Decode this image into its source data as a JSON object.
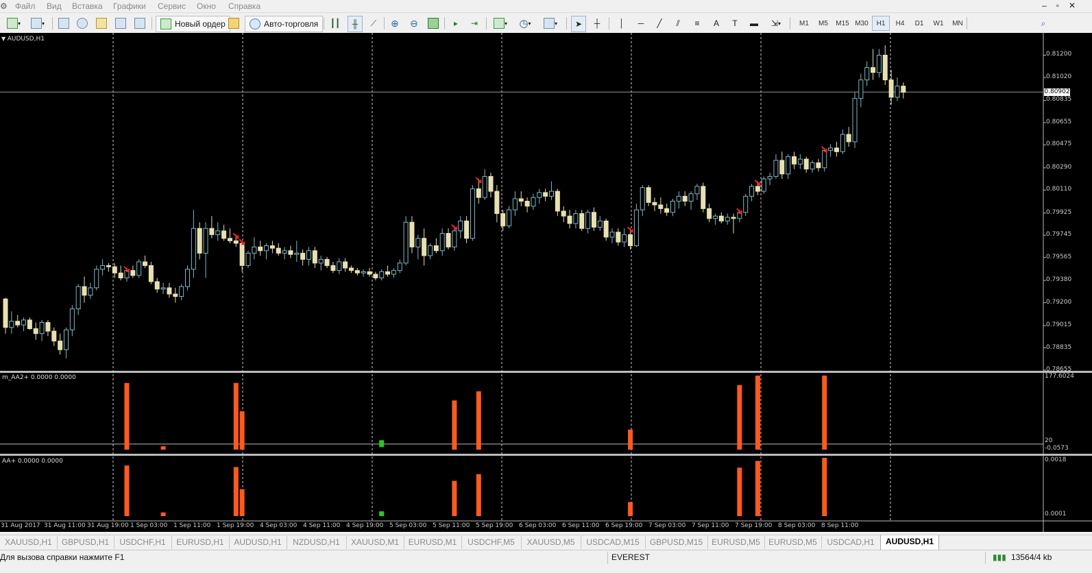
{
  "menu": [
    "Файл",
    "Вид",
    "Вставка",
    "Графики",
    "Сервис",
    "Окно",
    "Справка"
  ],
  "toolbar": {
    "new_order": "Новый ордер",
    "auto_trading": "Авто-торговля"
  },
  "timeframes": [
    "M1",
    "M5",
    "M15",
    "M30",
    "H1",
    "H4",
    "D1",
    "W1",
    "MN"
  ],
  "active_timeframe": "H1",
  "chart": {
    "title": "AUDUSD,H1",
    "current_price": "0.80902",
    "price_axis": [
      "0.81200",
      "0.81020",
      "0.80835",
      "0.80655",
      "0.80475",
      "0.80290",
      "0.80110",
      "0.79925",
      "0.79745",
      "0.79565",
      "0.79380",
      "0.79200",
      "0.79015",
      "0.78835",
      "0.78655"
    ],
    "time_axis": [
      "31 Aug 2017",
      "31 Aug 11:00",
      "31 Aug 19:00",
      "1 Sep 03:00",
      "1 Sep 11:00",
      "1 Sep 19:00",
      "4 Sep 03:00",
      "4 Sep 11:00",
      "4 Sep 19:00",
      "5 Sep 03:00",
      "5 Sep 11:00",
      "5 Sep 19:00",
      "6 Sep 03:00",
      "6 Sep 11:00",
      "6 Sep 19:00",
      "7 Sep 03:00",
      "7 Sep 11:00",
      "7 Sep 19:00",
      "8 Sep 03:00",
      "8 Sep 11:00"
    ]
  },
  "indicator1": {
    "label": "m_AA2+ 0.0000 0.0000",
    "axis_top": "177.6024",
    "axis_level": "20",
    "axis_bottom": "-0.0573"
  },
  "indicator2": {
    "label": "AA+ 0.0000 0.0000",
    "axis_top": "0.0018",
    "axis_bottom": "0.0001"
  },
  "tabs": [
    "XAUUSD,H1",
    "GBPUSD,H1",
    "USDCHF,H1",
    "EURUSD,H1",
    "AUDUSD,H1",
    "NZDUSD,H1",
    "XAUUSD,M1",
    "EURUSD,M1",
    "USDCHF,M5",
    "XAUUSD,M5",
    "USDCAD,M15",
    "GBPUSD,M15",
    "EURUSD,M5",
    "EURUSD,M5",
    "USDCAD,H1",
    "AUDUSD,H1"
  ],
  "active_tab_index": 15,
  "status": {
    "help": "Для вызова справки нажмите F1",
    "profile": "EVEREST",
    "traffic": "13564/4 kb"
  },
  "colors": {
    "chart_bg": "#000000",
    "bull_candle": "#7fb8c8",
    "bear_candle": "#e8e0b0",
    "histogram": "#ff5a1e",
    "signal_green": "#22cc22",
    "arrow": "#ff2020"
  },
  "chart_data": {
    "type": "candlestick",
    "symbol": "AUDUSD",
    "ylim": [
      0.78655,
      0.8138
    ],
    "ohlc": [
      [
        0.7923,
        0.7924,
        0.7895,
        0.79
      ],
      [
        0.79,
        0.7913,
        0.7895,
        0.7905
      ],
      [
        0.7905,
        0.791,
        0.79,
        0.7902
      ],
      [
        0.7902,
        0.7908,
        0.7897,
        0.7906
      ],
      [
        0.7906,
        0.7908,
        0.7898,
        0.7899
      ],
      [
        0.7899,
        0.7904,
        0.789,
        0.7895
      ],
      [
        0.7895,
        0.7906,
        0.7889,
        0.7904
      ],
      [
        0.7904,
        0.7906,
        0.7893,
        0.7897
      ],
      [
        0.7897,
        0.79,
        0.7885,
        0.7889
      ],
      [
        0.7889,
        0.7895,
        0.7878,
        0.7882
      ],
      [
        0.7882,
        0.79,
        0.7875,
        0.7898
      ],
      [
        0.7898,
        0.7918,
        0.7893,
        0.7915
      ],
      [
        0.7915,
        0.7935,
        0.791,
        0.7933
      ],
      [
        0.7933,
        0.7941,
        0.792,
        0.7926
      ],
      [
        0.7926,
        0.7936,
        0.7923,
        0.7932
      ],
      [
        0.7932,
        0.795,
        0.793,
        0.7947
      ],
      [
        0.7947,
        0.7955,
        0.7942,
        0.795
      ],
      [
        0.795,
        0.7952,
        0.7945,
        0.7949
      ],
      [
        0.7949,
        0.7952,
        0.794,
        0.7944
      ],
      [
        0.7944,
        0.795,
        0.7938,
        0.794
      ],
      [
        0.794,
        0.7948,
        0.7937,
        0.7946
      ],
      [
        0.7946,
        0.795,
        0.794,
        0.7942
      ],
      [
        0.7942,
        0.7955,
        0.794,
        0.7953
      ],
      [
        0.7953,
        0.7958,
        0.7948,
        0.795
      ],
      [
        0.795,
        0.7953,
        0.7935,
        0.7937
      ],
      [
        0.7937,
        0.794,
        0.7928,
        0.7931
      ],
      [
        0.7931,
        0.7936,
        0.7927,
        0.7932
      ],
      [
        0.7932,
        0.7936,
        0.7924,
        0.7927
      ],
      [
        0.7927,
        0.7932,
        0.792,
        0.7925
      ],
      [
        0.7925,
        0.7935,
        0.7922,
        0.7933
      ],
      [
        0.7933,
        0.795,
        0.793,
        0.7947
      ],
      [
        0.7947,
        0.7995,
        0.794,
        0.798
      ],
      [
        0.798,
        0.7985,
        0.7955,
        0.796
      ],
      [
        0.796,
        0.7985,
        0.794,
        0.798
      ],
      [
        0.798,
        0.799,
        0.7972,
        0.7975
      ],
      [
        0.7975,
        0.7985,
        0.797,
        0.7978
      ],
      [
        0.7978,
        0.7983,
        0.797,
        0.7972
      ],
      [
        0.7972,
        0.798,
        0.7968,
        0.797
      ],
      [
        0.797,
        0.7975,
        0.7965,
        0.7968
      ],
      [
        0.7968,
        0.797,
        0.7945,
        0.795
      ],
      [
        0.795,
        0.7962,
        0.7948,
        0.796
      ],
      [
        0.796,
        0.7973,
        0.7955,
        0.7965
      ],
      [
        0.7965,
        0.797,
        0.7958,
        0.7962
      ],
      [
        0.7962,
        0.7968,
        0.7955,
        0.7966
      ],
      [
        0.7966,
        0.797,
        0.796,
        0.7964
      ],
      [
        0.7964,
        0.7968,
        0.7958,
        0.796
      ],
      [
        0.796,
        0.7965,
        0.7955,
        0.7962
      ],
      [
        0.7962,
        0.7966,
        0.7956,
        0.7959
      ],
      [
        0.7959,
        0.797,
        0.7953,
        0.796
      ],
      [
        0.796,
        0.7963,
        0.795,
        0.7955
      ],
      [
        0.7955,
        0.7965,
        0.795,
        0.7962
      ],
      [
        0.7962,
        0.7965,
        0.7948,
        0.7952
      ],
      [
        0.7952,
        0.7958,
        0.7946,
        0.7955
      ],
      [
        0.7955,
        0.7957,
        0.7948,
        0.795
      ],
      [
        0.795,
        0.7953,
        0.7944,
        0.7946
      ],
      [
        0.7946,
        0.7956,
        0.7943,
        0.7953
      ],
      [
        0.7953,
        0.7956,
        0.7945,
        0.7948
      ],
      [
        0.7948,
        0.795,
        0.7944,
        0.7946
      ],
      [
        0.7946,
        0.7948,
        0.7942,
        0.7944
      ],
      [
        0.7944,
        0.7947,
        0.7941,
        0.7945
      ],
      [
        0.7945,
        0.7948,
        0.7941,
        0.7943
      ],
      [
        0.7943,
        0.7945,
        0.7938,
        0.794
      ],
      [
        0.794,
        0.7947,
        0.7938,
        0.7945
      ],
      [
        0.7945,
        0.795,
        0.7941,
        0.7943
      ],
      [
        0.7943,
        0.7948,
        0.794,
        0.7946
      ],
      [
        0.7946,
        0.7955,
        0.7944,
        0.7952
      ],
      [
        0.7952,
        0.799,
        0.795,
        0.7985
      ],
      [
        0.7985,
        0.799,
        0.796,
        0.7965
      ],
      [
        0.7965,
        0.7975,
        0.7955,
        0.7972
      ],
      [
        0.7972,
        0.798,
        0.795,
        0.7958
      ],
      [
        0.7958,
        0.7968,
        0.7955,
        0.7966
      ],
      [
        0.7966,
        0.7972,
        0.796,
        0.7962
      ],
      [
        0.7962,
        0.798,
        0.7958,
        0.7976
      ],
      [
        0.7976,
        0.798,
        0.7963,
        0.7965
      ],
      [
        0.7965,
        0.7982,
        0.7962,
        0.7978
      ],
      [
        0.7978,
        0.799,
        0.7972,
        0.7986
      ],
      [
        0.7986,
        0.799,
        0.7968,
        0.7972
      ],
      [
        0.7972,
        0.8015,
        0.797,
        0.8012
      ],
      [
        0.8012,
        0.802,
        0.8,
        0.8005
      ],
      [
        0.8005,
        0.8028,
        0.8003,
        0.8022
      ],
      [
        0.8022,
        0.8025,
        0.8005,
        0.801
      ],
      [
        0.801,
        0.8015,
        0.7985,
        0.7992
      ],
      [
        0.7992,
        0.7995,
        0.7978,
        0.7982
      ],
      [
        0.7982,
        0.7998,
        0.798,
        0.7995
      ],
      [
        0.7995,
        0.801,
        0.799,
        0.8004
      ],
      [
        0.8004,
        0.801,
        0.7998,
        0.8002
      ],
      [
        0.8002,
        0.8005,
        0.7993,
        0.7998
      ],
      [
        0.7998,
        0.8008,
        0.7995,
        0.8005
      ],
      [
        0.8005,
        0.8012,
        0.8,
        0.8009
      ],
      [
        0.8009,
        0.8012,
        0.8002,
        0.8006
      ],
      [
        0.8006,
        0.8018,
        0.8003,
        0.801
      ],
      [
        0.801,
        0.8012,
        0.799,
        0.7994
      ],
      [
        0.7994,
        0.7998,
        0.7985,
        0.799
      ],
      [
        0.799,
        0.7995,
        0.798,
        0.7984
      ],
      [
        0.7984,
        0.7995,
        0.798,
        0.7992
      ],
      [
        0.7992,
        0.7995,
        0.7978,
        0.798
      ],
      [
        0.798,
        0.7995,
        0.7976,
        0.7993
      ],
      [
        0.7993,
        0.7997,
        0.7978,
        0.7981
      ],
      [
        0.7981,
        0.799,
        0.7978,
        0.7986
      ],
      [
        0.7986,
        0.7988,
        0.797,
        0.7973
      ],
      [
        0.7973,
        0.798,
        0.7968,
        0.7977
      ],
      [
        0.7977,
        0.798,
        0.7966,
        0.7969
      ],
      [
        0.7969,
        0.798,
        0.7965,
        0.7975
      ],
      [
        0.7975,
        0.798,
        0.7963,
        0.7966
      ],
      [
        0.7966,
        0.8,
        0.7965,
        0.7995
      ],
      [
        0.7995,
        0.8015,
        0.799,
        0.8013
      ],
      [
        0.8013,
        0.8015,
        0.7998,
        0.8001
      ],
      [
        0.8001,
        0.8005,
        0.7994,
        0.7999
      ],
      [
        0.7999,
        0.8005,
        0.7992,
        0.7996
      ],
      [
        0.7996,
        0.8,
        0.799,
        0.7993
      ],
      [
        0.7993,
        0.8004,
        0.799,
        0.8002
      ],
      [
        0.8002,
        0.801,
        0.7996,
        0.8006
      ],
      [
        0.8006,
        0.801,
        0.7998,
        0.8002
      ],
      [
        0.8002,
        0.801,
        0.7995,
        0.8008
      ],
      [
        0.8008,
        0.8016,
        0.8003,
        0.8014
      ],
      [
        0.8014,
        0.8017,
        0.7993,
        0.7996
      ],
      [
        0.7996,
        0.8,
        0.7985,
        0.7988
      ],
      [
        0.7988,
        0.7992,
        0.7983,
        0.799
      ],
      [
        0.799,
        0.7993,
        0.7984,
        0.7986
      ],
      [
        0.7986,
        0.7992,
        0.7983,
        0.7989
      ],
      [
        0.7989,
        0.7992,
        0.7976,
        0.7988
      ],
      [
        0.7988,
        0.7995,
        0.7985,
        0.7993
      ],
      [
        0.7993,
        0.8008,
        0.799,
        0.8006
      ],
      [
        0.8006,
        0.8016,
        0.8002,
        0.8014
      ],
      [
        0.8014,
        0.8018,
        0.8007,
        0.801
      ],
      [
        0.801,
        0.8022,
        0.8008,
        0.802
      ],
      [
        0.802,
        0.8025,
        0.8015,
        0.8022
      ],
      [
        0.8022,
        0.804,
        0.802,
        0.8035
      ],
      [
        0.8035,
        0.8042,
        0.802,
        0.8024
      ],
      [
        0.8024,
        0.804,
        0.802,
        0.8038
      ],
      [
        0.8038,
        0.8042,
        0.8028,
        0.8032
      ],
      [
        0.8032,
        0.804,
        0.8028,
        0.8036
      ],
      [
        0.8036,
        0.8038,
        0.8025,
        0.8028
      ],
      [
        0.8028,
        0.8035,
        0.8025,
        0.8033
      ],
      [
        0.8033,
        0.8036,
        0.8026,
        0.8029
      ],
      [
        0.8029,
        0.8045,
        0.8026,
        0.8043
      ],
      [
        0.8043,
        0.8048,
        0.8038,
        0.8045
      ],
      [
        0.8045,
        0.805,
        0.8038,
        0.8042
      ],
      [
        0.8042,
        0.806,
        0.804,
        0.8056
      ],
      [
        0.8056,
        0.8062,
        0.8046,
        0.805
      ],
      [
        0.805,
        0.809,
        0.8045,
        0.8085
      ],
      [
        0.8085,
        0.8105,
        0.8078,
        0.81
      ],
      [
        0.81,
        0.8115,
        0.8095,
        0.811
      ],
      [
        0.811,
        0.8125,
        0.81,
        0.8106
      ],
      [
        0.8106,
        0.8125,
        0.8102,
        0.812
      ],
      [
        0.812,
        0.8128,
        0.8096,
        0.81
      ],
      [
        0.81,
        0.8108,
        0.808,
        0.8086
      ],
      [
        0.8086,
        0.8102,
        0.8083,
        0.8095
      ],
      [
        0.8095,
        0.8098,
        0.8085,
        0.809
      ]
    ],
    "arrow_bars": [
      20,
      38,
      39,
      74,
      78,
      103,
      121,
      124,
      135
    ],
    "indicator1_bars": [
      [
        20,
        160
      ],
      [
        26,
        8
      ],
      [
        38,
        160
      ],
      [
        39,
        92
      ],
      [
        74,
        118
      ],
      [
        78,
        140
      ],
      [
        103,
        48
      ],
      [
        121,
        155
      ],
      [
        124,
        177.6
      ],
      [
        135,
        177.6
      ]
    ],
    "indicator1_green_bars": [
      [
        62,
        16
      ]
    ],
    "indicator2_bars": [
      [
        20,
        0.00165
      ],
      [
        26,
        0.00012
      ],
      [
        38,
        0.0016
      ],
      [
        39,
        0.00088
      ],
      [
        74,
        0.00115
      ],
      [
        78,
        0.00137
      ],
      [
        103,
        0.00046
      ],
      [
        121,
        0.00158
      ],
      [
        124,
        0.0018
      ],
      [
        135,
        0.0019
      ]
    ],
    "indicator2_green_bars": [
      [
        62,
        0.00018
      ]
    ]
  }
}
